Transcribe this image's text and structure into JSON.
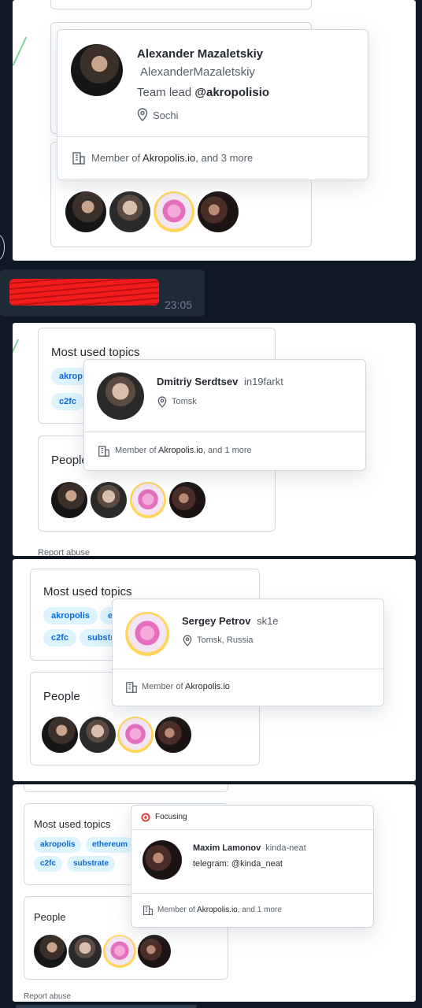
{
  "panel1": {
    "name": "Alexander Mazaletskiy",
    "login": "AlexanderMazaletskiy",
    "bio_prefix": "Team lead ",
    "bio_org": "@akropolisio",
    "location": "Sochi",
    "member_prefix": "Member of ",
    "member_org": "Akropolis.io",
    "member_suffix": ", and 3 more"
  },
  "chat": {
    "time": "23:05"
  },
  "panel2": {
    "topics_title": "Most used topics",
    "topics": [
      "akrop",
      "c2fc"
    ],
    "people_title": "People",
    "name": "Dmitriy Serdtsev",
    "login": "in19farkt",
    "location": "Tomsk",
    "member_prefix": "Member of ",
    "member_org": "Akropolis.io",
    "member_suffix": ", and 1 more",
    "report": "Report abuse"
  },
  "panel3": {
    "topics_title": "Most used topics",
    "topics": [
      "akropolis",
      "e",
      "c2fc",
      "substra"
    ],
    "people_title": "People",
    "name": "Sergey Petrov",
    "login": "sk1e",
    "location": "Tomsk, Russia",
    "member_prefix": "Member of ",
    "member_org": "Akropolis.io"
  },
  "panel4": {
    "topics_title": "Most used topics",
    "topics": [
      "akropolis",
      "ethereum",
      "c2fc",
      "substrate"
    ],
    "people_title": "People",
    "status": "Focusing",
    "name": "Maxim Lamonov",
    "login": "kinda-neat",
    "bio": "telegram: @kinda_neat",
    "member_prefix": "Member of ",
    "member_org": "Akropolis.io",
    "member_suffix": ", and 1 more",
    "report": "Report abuse"
  },
  "colors": {
    "dark_bg": "#0f1923",
    "topic_bg": "#ddf4ff",
    "topic_text": "#0969da",
    "redaction": "#ff1a1a"
  },
  "icons": [
    "location-pin-icon",
    "building-icon",
    "target-emoji-icon"
  ]
}
